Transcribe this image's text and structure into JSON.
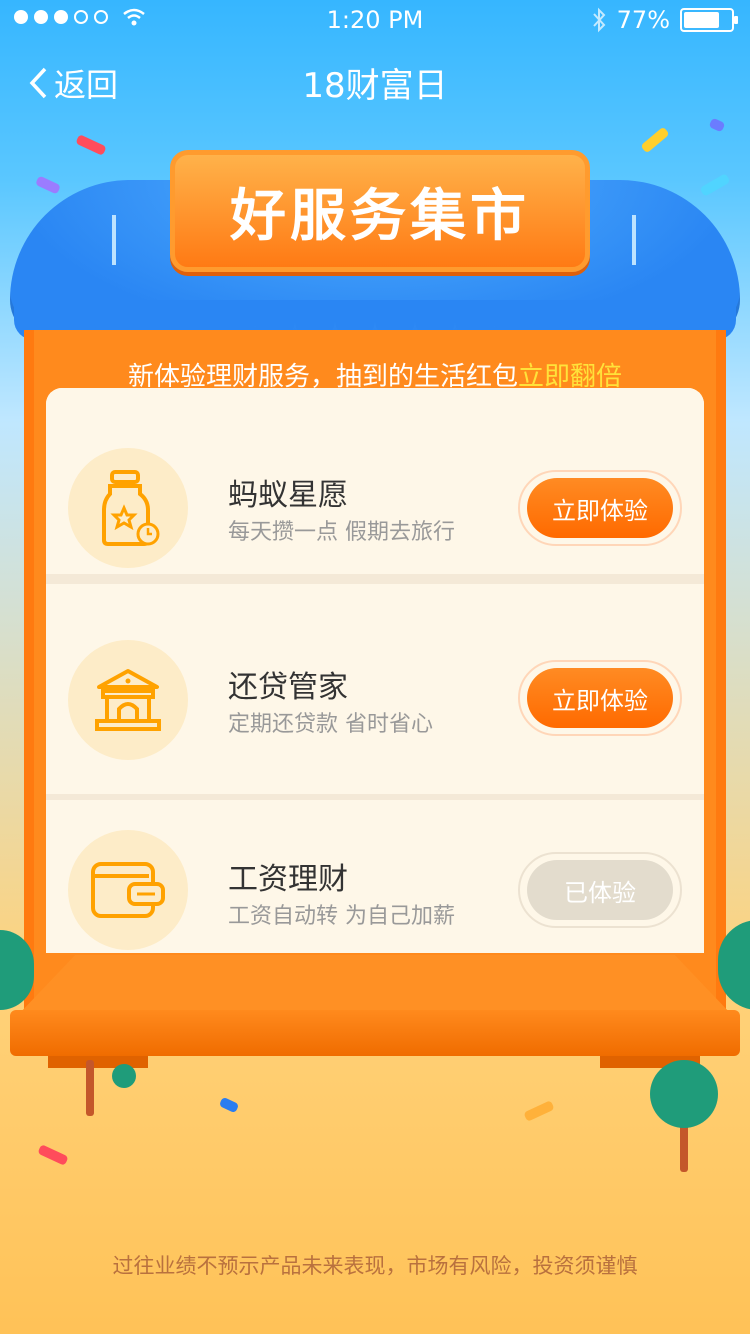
{
  "status_bar": {
    "time": "1:20 PM",
    "battery": "77%",
    "battery_level": 0.77,
    "signal_dots": 5,
    "signal_filled": 3
  },
  "nav": {
    "back_label": "返回",
    "title": "18财富日"
  },
  "banner": {
    "title": "好服务集市"
  },
  "subtitle": {
    "prefix": "新体验理财服务，抽到的生活红包",
    "highlight": "立即翻倍"
  },
  "services": [
    {
      "name": "蚂蚁星愿",
      "desc": "每天攒一点 假期去旅行",
      "button": "立即体验",
      "done": false,
      "icon": "jar-star-icon"
    },
    {
      "name": "还贷管家",
      "desc": "定期还贷款 省时省心",
      "button": "立即体验",
      "done": false,
      "icon": "bank-icon"
    },
    {
      "name": "工资理财",
      "desc": "工资自动转 为自己加薪",
      "button": "已体验",
      "done": true,
      "icon": "wallet-icon"
    }
  ],
  "footer": {
    "disclaimer": "过往业绩不预示产品未来表现，市场有风险，投资须谨慎"
  },
  "colors": {
    "accent": "#ff7a14",
    "highlight": "#ffe23a",
    "icon": "#ffa200"
  }
}
